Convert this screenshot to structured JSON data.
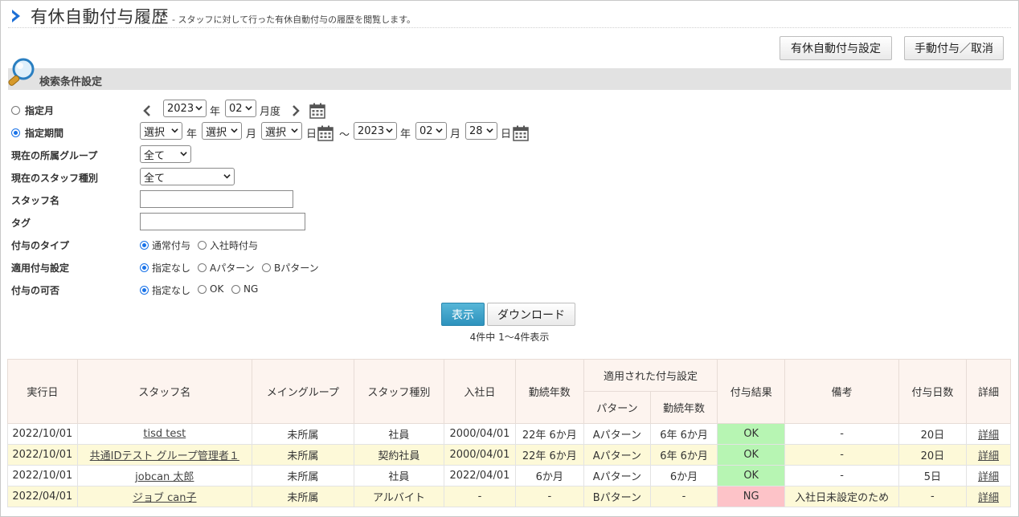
{
  "page": {
    "title": "有休自動付与履歴",
    "subtitle": "- スタッフに対して行った有休自動付与の履歴を閲覧します。",
    "btn_auto_setting": "有休自動付与設定",
    "btn_manual": "手動付与／取消"
  },
  "search": {
    "header": "検索条件設定",
    "month_label": "指定月",
    "period_label": "指定期間",
    "group_label": "現在の所属グループ",
    "staff_type_label": "現在のスタッフ種別",
    "staff_name_label": "スタッフ名",
    "tag_label": "タグ",
    "grant_type_label": "付与のタイプ",
    "apply_setting_label": "適用付与設定",
    "grant_ok_label": "付与の可否",
    "month_year": "2023",
    "month_month": "02",
    "unit_year": "年",
    "unit_month_do": "月度",
    "unit_month": "月",
    "unit_day": "日",
    "tilde": "～",
    "period_from_year": "選択",
    "period_from_month": "選択",
    "period_from_day": "選択",
    "period_to_year": "2023",
    "period_to_month": "02",
    "period_to_day": "28",
    "group_value": "全て",
    "staff_type_value": "全て",
    "grant_type_options": [
      "通常付与",
      "入社時付与"
    ],
    "apply_options": [
      "指定なし",
      "Aパターン",
      "Bパターン"
    ],
    "ok_options": [
      "指定なし",
      "OK",
      "NG"
    ],
    "show_button": "表示",
    "download_button": "ダウンロード",
    "count_text": "4件中 1～4件表示"
  },
  "table": {
    "headers": {
      "date": "実行日",
      "staff": "スタッフ名",
      "group": "メイングループ",
      "type": "スタッフ種別",
      "join": "入社日",
      "years": "勤続年数",
      "applied": "適用された付与設定",
      "pattern": "パターン",
      "applied_years": "勤続年数",
      "result": "付与結果",
      "note": "備考",
      "days": "付与日数",
      "detail": "詳細"
    },
    "rows": [
      {
        "date": "2022/10/01",
        "staff": "tisd test",
        "group": "未所属",
        "type": "社員",
        "join": "2000/04/01",
        "years": "22年 6か月",
        "pattern": "Aパターン",
        "applied_years": "6年 6か月",
        "result": "OK",
        "note": "-",
        "days": "20日",
        "detail": "詳細"
      },
      {
        "date": "2022/10/01",
        "staff": "共通IDテスト グループ管理者１",
        "group": "未所属",
        "type": "契約社員",
        "join": "2000/04/01",
        "years": "22年 6か月",
        "pattern": "Aパターン",
        "applied_years": "6年 6か月",
        "result": "OK",
        "note": "-",
        "days": "20日",
        "detail": "詳細"
      },
      {
        "date": "2022/10/01",
        "staff": "jobcan 太郎",
        "group": "未所属",
        "type": "社員",
        "join": "2022/04/01",
        "years": "6か月",
        "pattern": "Aパターン",
        "applied_years": "6か月",
        "result": "OK",
        "note": "-",
        "days": "5日",
        "detail": "詳細"
      },
      {
        "date": "2022/04/01",
        "staff": "ジョブ can子",
        "group": "未所属",
        "type": "アルバイト",
        "join": "-",
        "years": "-",
        "pattern": "Bパターン",
        "applied_years": "-",
        "result": "NG",
        "note": "入社日未設定のため",
        "days": "-",
        "detail": "詳細"
      }
    ]
  },
  "colors": {
    "ok": "#b7f5b3",
    "ng": "#fdc3c8",
    "accent": "#1a73e8",
    "show_button": "#2d92bd"
  }
}
